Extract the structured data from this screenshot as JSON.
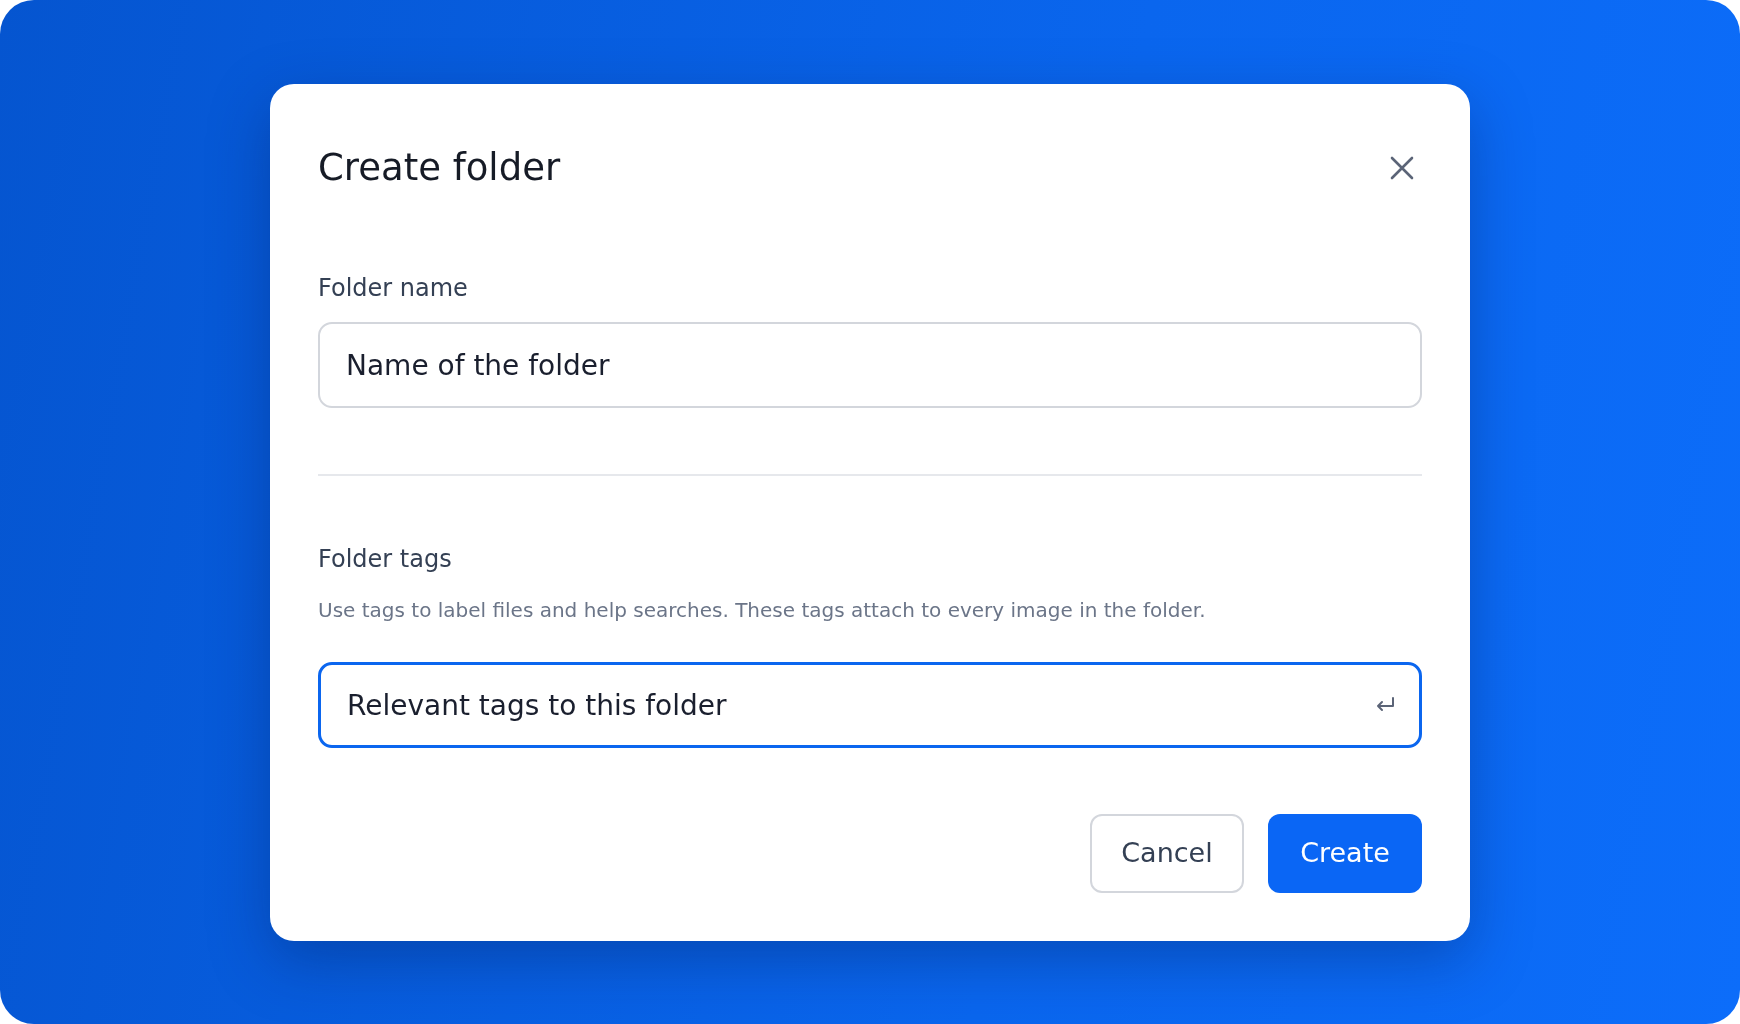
{
  "dialog": {
    "title": "Create folder",
    "fields": [
      {
        "label": "Folder name",
        "value": "Name of the folder",
        "focused": false
      },
      {
        "label": "Folder tags",
        "hint": "Use tags to label files and help searches. These tags attach to every image in the folder.",
        "value": "Relevant tags to this folder",
        "focused": true
      }
    ],
    "buttons": [
      {
        "label": "Cancel",
        "kind": "secondary"
      },
      {
        "label": "Create",
        "kind": "primary"
      }
    ]
  }
}
